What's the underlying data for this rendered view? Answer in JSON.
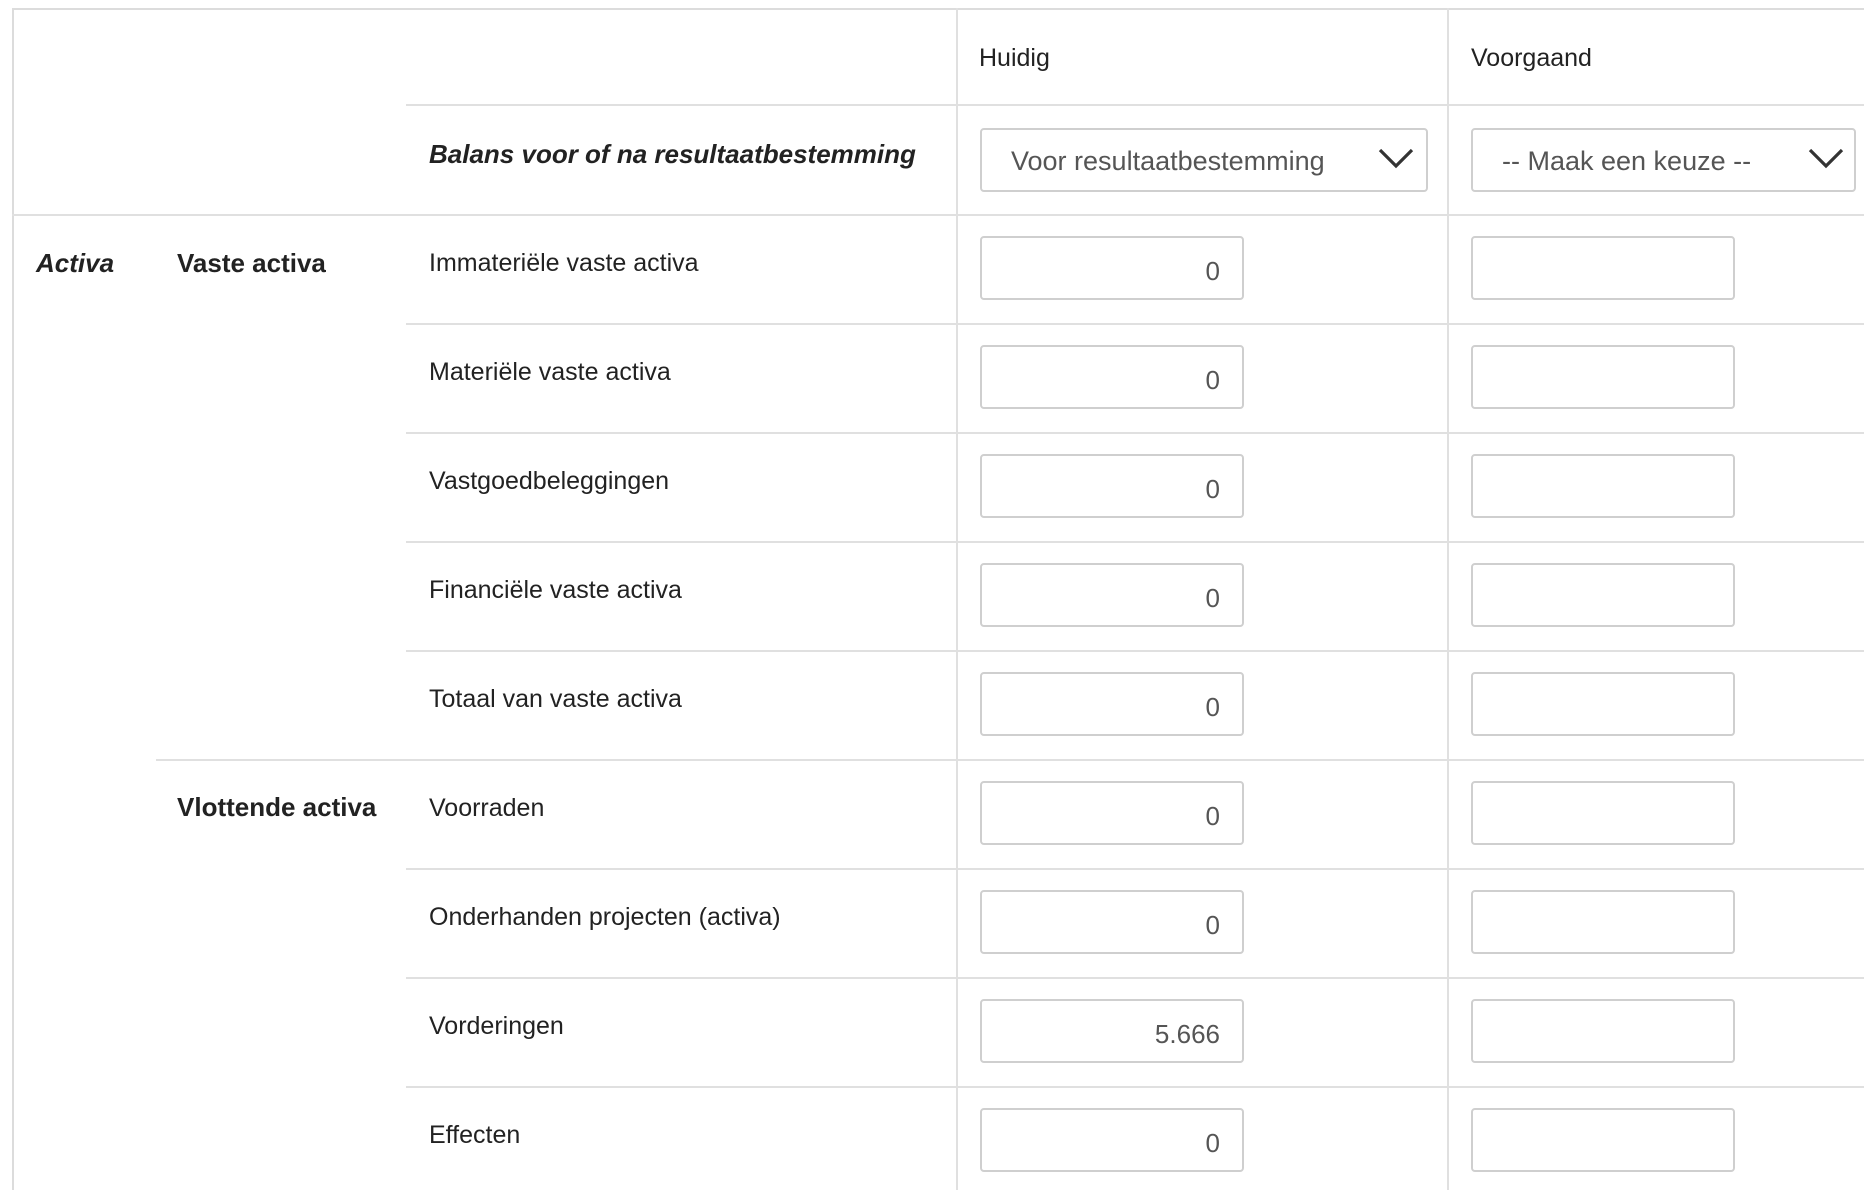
{
  "headers": {
    "current": "Huidig",
    "previous": "Voorgaand"
  },
  "balance_setting": {
    "label": "Balans voor of na resultaatbestemming",
    "current_value": "Voor resultaatbestemming",
    "previous_value": "-- Maak een keuze --"
  },
  "section": {
    "label": "Activa"
  },
  "groups": {
    "vaste": "Vaste activa",
    "vlottende": "Vlottende activa"
  },
  "rows": [
    {
      "label": "Immateriële vaste activa",
      "current": "0",
      "previous": ""
    },
    {
      "label": "Materiële vaste activa",
      "current": "0",
      "previous": ""
    },
    {
      "label": "Vastgoedbeleggingen",
      "current": "0",
      "previous": ""
    },
    {
      "label": "Financiële vaste activa",
      "current": "0",
      "previous": ""
    },
    {
      "label": "Totaal van vaste activa",
      "current": "0",
      "previous": ""
    },
    {
      "label": "Voorraden",
      "current": "0",
      "previous": ""
    },
    {
      "label": "Onderhanden projecten (activa)",
      "current": "0",
      "previous": ""
    },
    {
      "label": "Vorderingen",
      "current": "5.666",
      "previous": ""
    },
    {
      "label": "Effecten",
      "current": "0",
      "previous": ""
    }
  ],
  "icons": {
    "dropdown": "chevron-down-icon"
  },
  "colors": {
    "border": "#e0e0e0",
    "input_border": "#cfcfcf",
    "text": "#222222",
    "input_text": "#555555"
  }
}
